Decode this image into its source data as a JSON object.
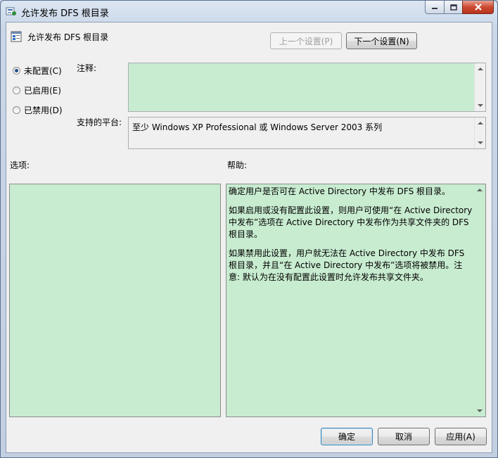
{
  "window": {
    "title": "允许发布 DFS 根目录"
  },
  "header": {
    "policy_title": "允许发布 DFS 根目录",
    "prev_button": "上一个设置(P)",
    "next_button": "下一个设置(N)"
  },
  "state": {
    "options": [
      {
        "label": "未配置(C)",
        "checked": true
      },
      {
        "label": "已启用(E)",
        "checked": false
      },
      {
        "label": "已禁用(D)",
        "checked": false
      }
    ]
  },
  "comment": {
    "label": "注释:",
    "value": ""
  },
  "platform": {
    "label": "支持的平台:",
    "value": "至少 Windows XP Professional 或 Windows Server 2003 系列"
  },
  "options_section": {
    "label": "选项:"
  },
  "help_section": {
    "label": "帮助:",
    "paragraphs": [
      "确定用户是否可在 Active Directory 中发布 DFS 根目录。",
      "如果启用或没有配置此设置，则用户可使用“在 Active Directory 中发布”选项在 Active Directory 中发布作为共享文件夹的 DFS 根目录。",
      "如果禁用此设置，用户就无法在 Active Directory 中发布 DFS 根目录，并且“在 Active Directory 中发布”选项将被禁用。注意: 默认为在没有配置此设置时允许发布共享文件夹。"
    ]
  },
  "footer": {
    "ok_button": "确定",
    "cancel_button": "取消",
    "apply_button": "应用(A)"
  },
  "colors": {
    "textbox_bg": "#c8ecd0",
    "accent": "#1f4f8b"
  }
}
